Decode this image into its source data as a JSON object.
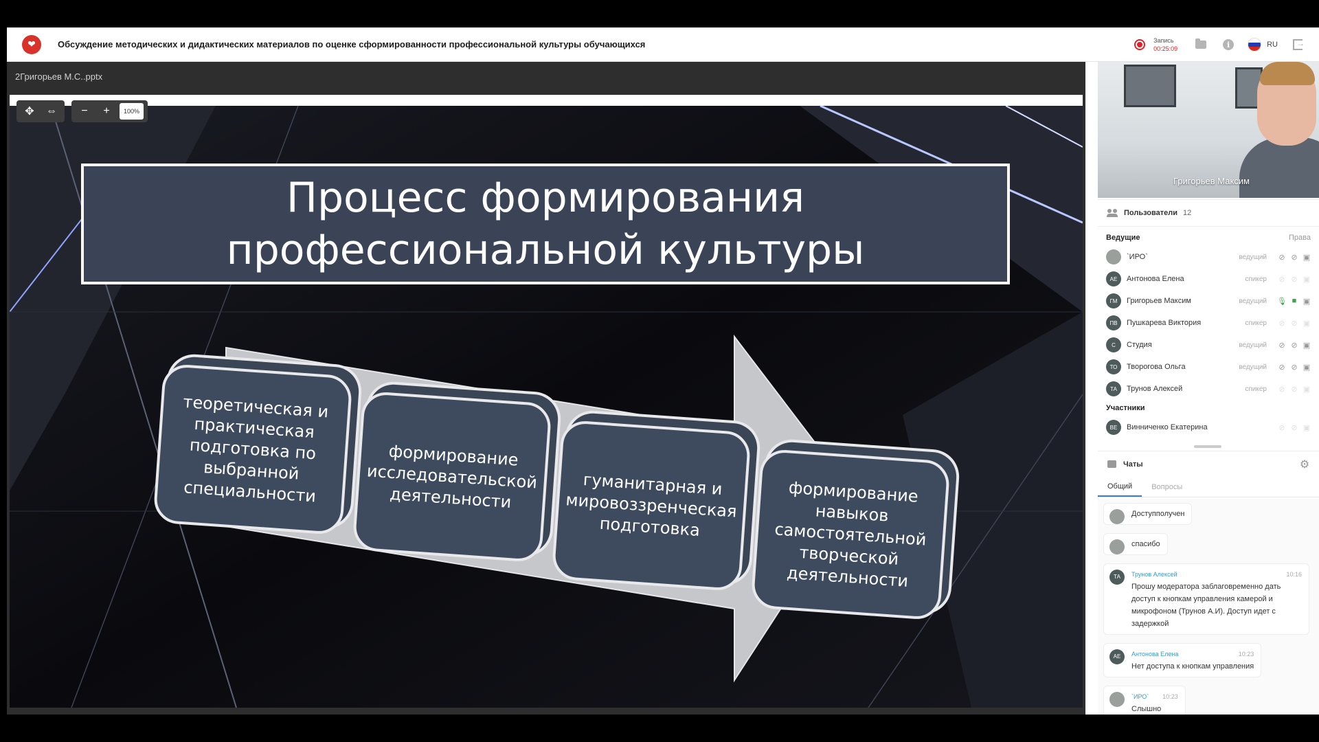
{
  "header": {
    "logo_text": "❤",
    "title": "Обсуждение методических и дидактических материалов по оценке сформированности профессиональной культуры обучающихся",
    "record_label": "Запись",
    "record_time": "00:25:09",
    "language": "RU"
  },
  "presentation": {
    "file_name": "2Григорьев М.С..pptx",
    "zoom": "100%",
    "zoom_out_label": "−",
    "zoom_in_label": "+",
    "slide": {
      "title_line1": "Процесс формирования",
      "title_line2": "профессиональной культуры",
      "steps": [
        "теоретическая и практическая подготовка по выбранной специальности",
        "формирование исследовательской деятельности",
        "гуманитарная и мировоззренческая подготовка",
        "формирование навыков самостоятельной творческой деятельности"
      ]
    }
  },
  "video": {
    "name": "Григорьев Максим"
  },
  "users": {
    "header": "Пользователи",
    "count": "12",
    "hosts_label": "Ведущие",
    "rights_label": "Права",
    "participants_label": "Участники",
    "hosts": [
      {
        "initials": "",
        "name": "`ИРО`",
        "role": "ведущий"
      },
      {
        "initials": "АЕ",
        "name": "Антонова Елена",
        "role": "спикер"
      },
      {
        "initials": "ГМ",
        "name": "Григорьев Максим",
        "role": "ведущий"
      },
      {
        "initials": "ПВ",
        "name": "Пушкарева Виктория",
        "role": "спикер"
      },
      {
        "initials": "С",
        "name": "Студия",
        "role": "ведущий"
      },
      {
        "initials": "ТО",
        "name": "Творогова Ольга",
        "role": "ведущий"
      },
      {
        "initials": "ТА",
        "name": "Трунов Алексей",
        "role": "спикер"
      }
    ],
    "participants": [
      {
        "initials": "ВЕ",
        "name": "Винниченко Екатерина",
        "role": ""
      }
    ]
  },
  "chat": {
    "header": "Чаты",
    "tabs": [
      "Общий",
      "Вопросы"
    ],
    "messages": [
      {
        "initials": "",
        "author": "",
        "time": "",
        "text": "Доступполучен"
      },
      {
        "initials": "",
        "author": "",
        "time": "",
        "text": "спасибо"
      },
      {
        "initials": "ТА",
        "author": "Трунов Алексей",
        "time": "10:16",
        "text": "Прошу модератора заблаговременно дать доступ к кнопкам управления камерой и микрофоном (Трунов А.И). Доступ идет с задержкой"
      },
      {
        "initials": "АЕ",
        "author": "Антонова Елена",
        "time": "10:23",
        "text": "Нет доступа к кнопкам управления"
      },
      {
        "initials": "",
        "author": "`ИРО`",
        "time": "10:23",
        "text": "Слышно"
      }
    ]
  },
  "colors": {
    "slide_box": "#3b4456",
    "step_box": "#3e4b5e",
    "record": "#e0202a",
    "link": "#3a9ac6"
  }
}
